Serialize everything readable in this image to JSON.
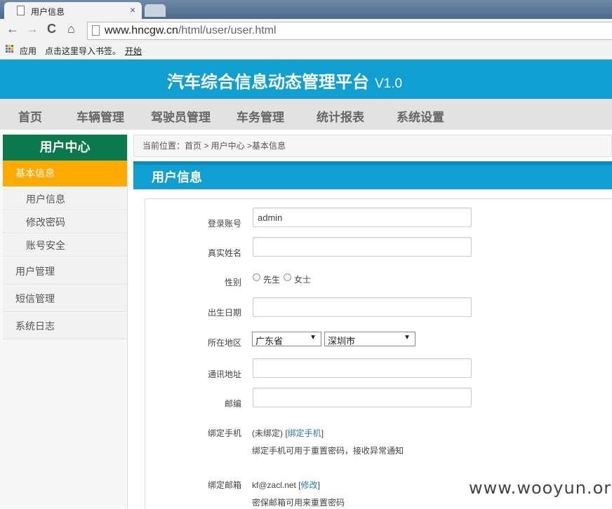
{
  "browser": {
    "tab_title": "用户信息",
    "tab_close": "×",
    "url_host": "www.hncgw.cn",
    "url_path": "/html/user/user.html",
    "back": "←",
    "forward": "→",
    "reload": "C",
    "home": "⌂",
    "bookmarks": {
      "apps": "应用",
      "import": "点击这里导入书签。",
      "start": "开始"
    }
  },
  "site": {
    "title": "汽车综合信息动态管理平台",
    "version": "V1.0",
    "nav": [
      "首页",
      "车辆管理",
      "驾驶员管理",
      "车务管理",
      "统计报表",
      "系统设置"
    ]
  },
  "sidebar": {
    "header": "用户中心",
    "active": "基本信息",
    "subitems": [
      "用户信息",
      "修改密码",
      "账号安全"
    ],
    "groups": [
      "用户管理",
      "短信管理",
      "系统日志"
    ]
  },
  "breadcrumb": "当前位置：首页 > 用户中心 >基本信息",
  "page_title": "用户信息",
  "form": {
    "login_label": "登录账号",
    "login_value": "admin",
    "realname_label": "真实姓名",
    "realname_value": "",
    "gender_label": "性别",
    "gender_male": "先生",
    "gender_female": "女士",
    "birth_label": "出生日期",
    "birth_value": "",
    "region_label": "所在地区",
    "province": "广东省",
    "city": "深圳市",
    "address_label": "通讯地址",
    "address_value": "",
    "zip_label": "邮编",
    "zip_value": "",
    "phone_label": "绑定手机",
    "phone_status": "(未绑定) [",
    "phone_link": "绑定手机",
    "phone_close": "]",
    "phone_hint": "绑定手机可用于重置密码，接收异常通知",
    "email_label": "绑定邮箱",
    "email_value": "kf@zacl.net [",
    "email_link": "修改",
    "email_close": "]",
    "email_hint": "密保邮箱可用来重置密码"
  },
  "watermark": "www.wooyun.org",
  "colors": {
    "header": "#0f9fd0",
    "sidebar_header": "#0a7a4e",
    "active_item": "#ffaa00",
    "link": "#2a77c2"
  }
}
